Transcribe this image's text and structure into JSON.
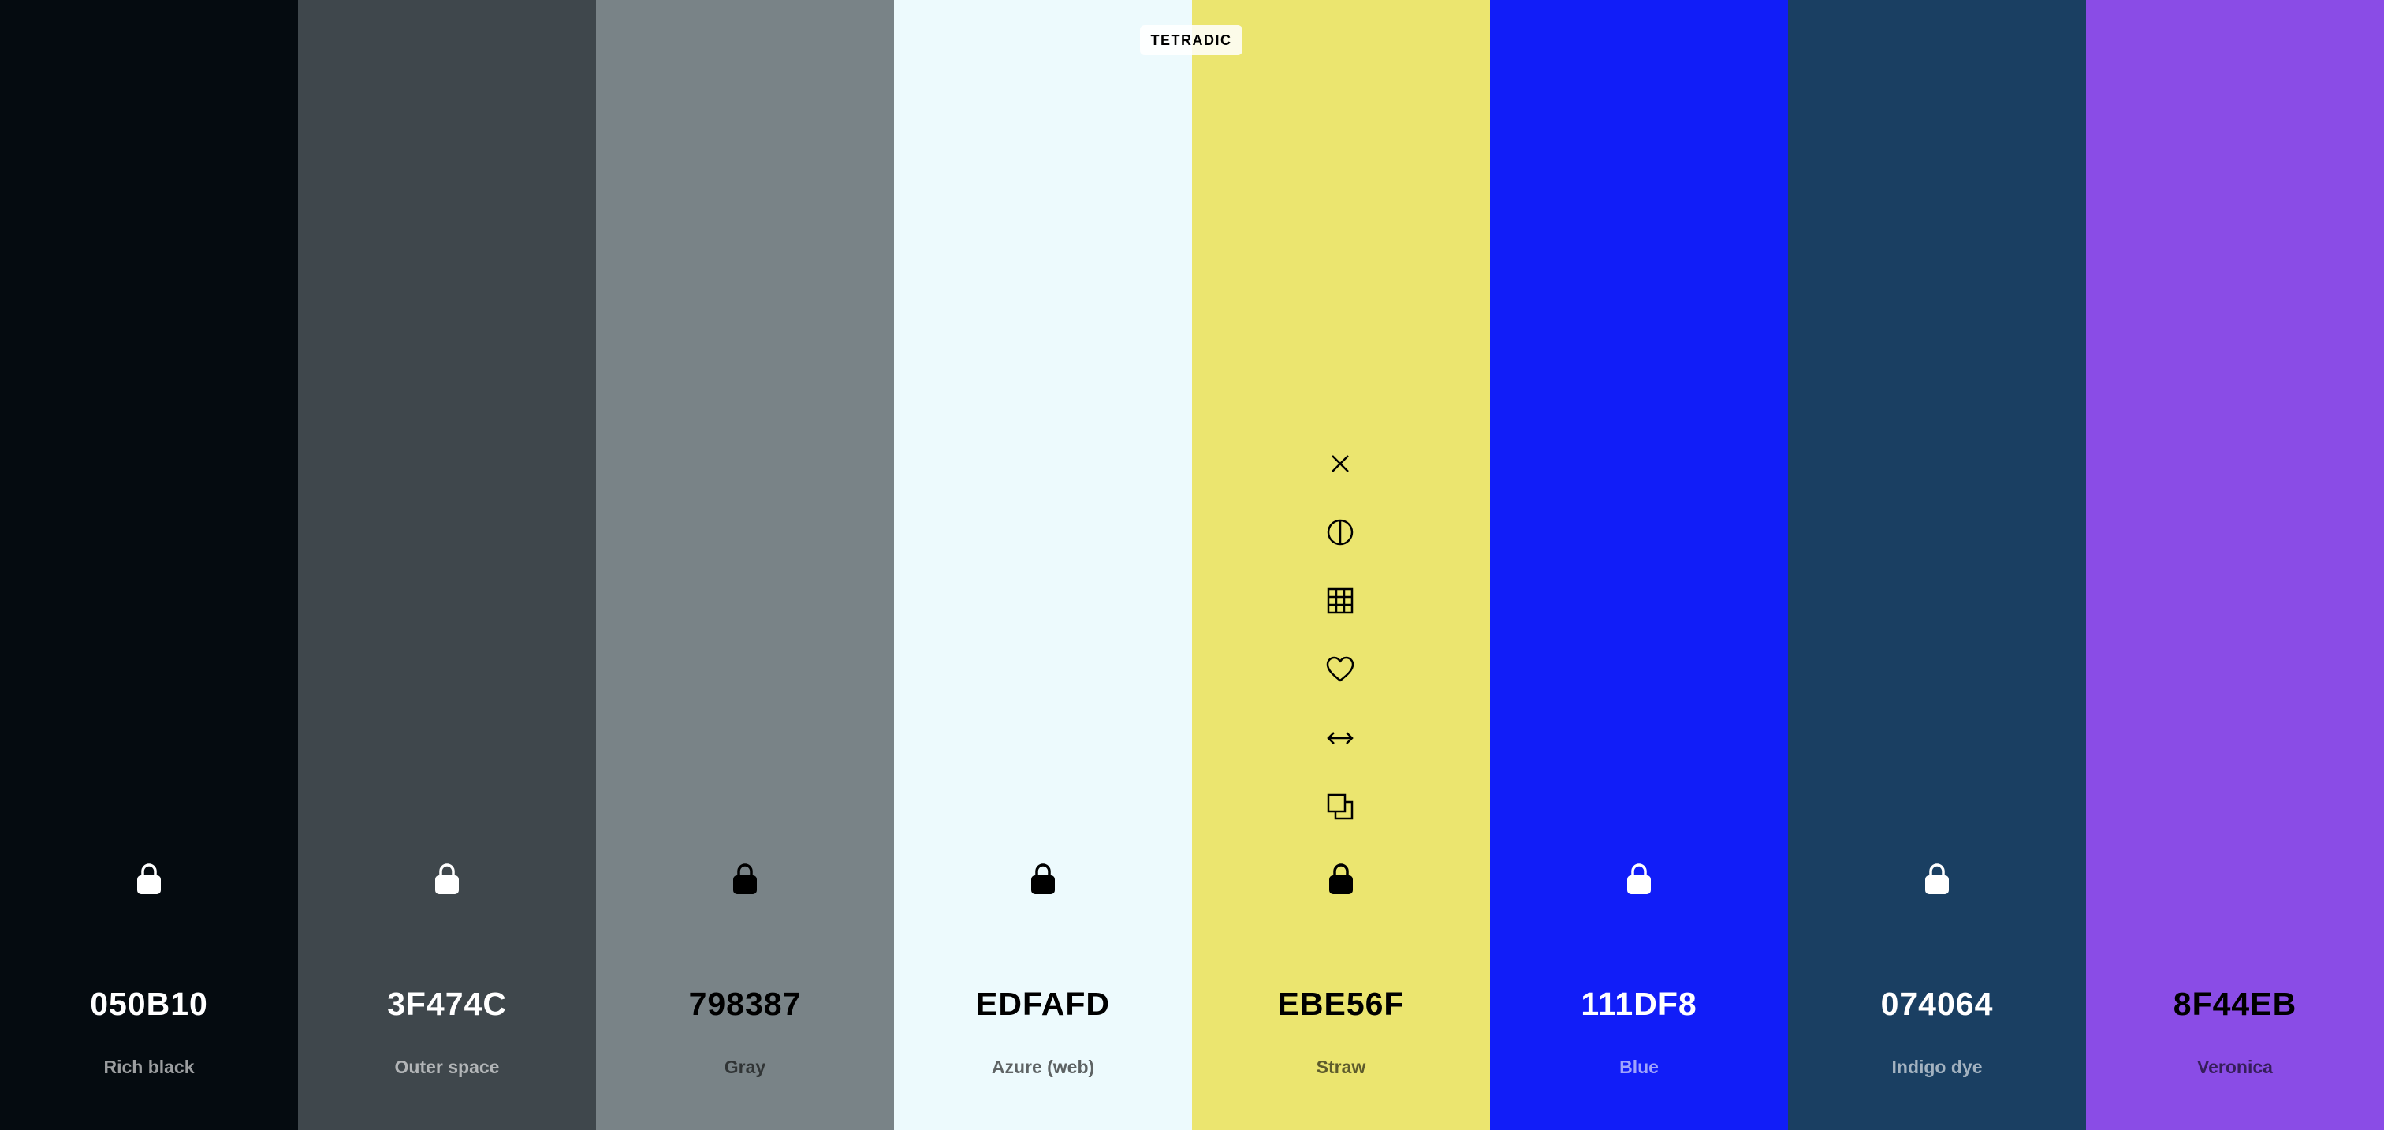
{
  "badge": {
    "label": "TETRADIC"
  },
  "swatches": [
    {
      "hex": "050B10",
      "name": "Rich black",
      "bg": "#050B10",
      "text": "#FFFFFF",
      "lock_color": "#FFFFFF"
    },
    {
      "hex": "3F474C",
      "name": "Outer space",
      "bg": "#3F474C",
      "text": "#FFFFFF",
      "lock_color": "#FFFFFF"
    },
    {
      "hex": "798387",
      "name": "Gray",
      "bg": "#798387",
      "text": "#000000",
      "lock_color": "#000000"
    },
    {
      "hex": "EDFAFD",
      "name": "Azure (web)",
      "bg": "#EDFAFD",
      "text": "#000000",
      "lock_color": "#000000"
    },
    {
      "hex": "EBE56F",
      "name": "Straw",
      "bg": "#EBE56F",
      "text": "#000000",
      "lock_color": "#000000"
    },
    {
      "hex": "111DF8",
      "name": "Blue",
      "bg": "#111DF8",
      "text": "#FFFFFF",
      "lock_color": "#FFFFFF"
    },
    {
      "hex": "074064",
      "name": "Indigo dye",
      "bg": "#1A3F62",
      "text": "#FFFFFF",
      "lock_color": "#FFFFFF"
    },
    {
      "hex": "8F44EB",
      "name": "Veronica",
      "bg": "#8A4CE6",
      "text": "#000000",
      "lock_color": "#FFFFFF"
    }
  ],
  "toolbar": {
    "icons": [
      "close-icon",
      "contrast-icon",
      "grid-icon",
      "heart-icon",
      "drag-icon",
      "copy-icon"
    ]
  }
}
